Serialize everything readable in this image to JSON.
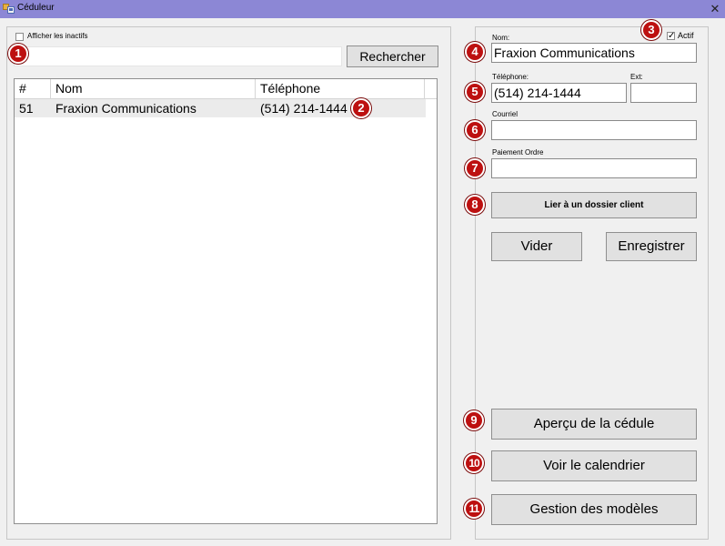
{
  "window": {
    "title": "Céduleur",
    "close_symbol": "✕"
  },
  "search": {
    "show_inactive_label": "Afficher les inactifs",
    "query": "",
    "button_label": "Rechercher"
  },
  "list": {
    "columns": [
      "#",
      "Nom",
      "Téléphone"
    ],
    "rows": [
      {
        "id": "51",
        "name": "Fraxion Communications",
        "phone": "(514) 214-1444"
      }
    ]
  },
  "form": {
    "active_label": "Actif",
    "active_checked": true,
    "check_mark": "✓",
    "name_label": "Nom:",
    "name_value": "Fraxion Communications",
    "phone_label": "Téléphone:",
    "phone_value": "(514) 214-1444",
    "ext_label": "Ext:",
    "ext_value": "",
    "email_label": "Courriel",
    "email_value": "",
    "payment_label": "Paiement Ordre",
    "payment_value": "",
    "link_button": "Lier à un dossier client",
    "clear_button": "Vider",
    "save_button": "Enregistrer"
  },
  "actions": {
    "preview_button": "Aperçu de la cédule",
    "calendar_button": "Voir le calendrier",
    "templates_button": "Gestion des modèles"
  },
  "callouts": [
    "1",
    "2",
    "3",
    "4",
    "5",
    "6",
    "7",
    "8",
    "9",
    "10",
    "11"
  ],
  "colors": {
    "callout": "#bd1010",
    "titlebar": "#8c87d5",
    "row_selected": "#ebebeb"
  }
}
